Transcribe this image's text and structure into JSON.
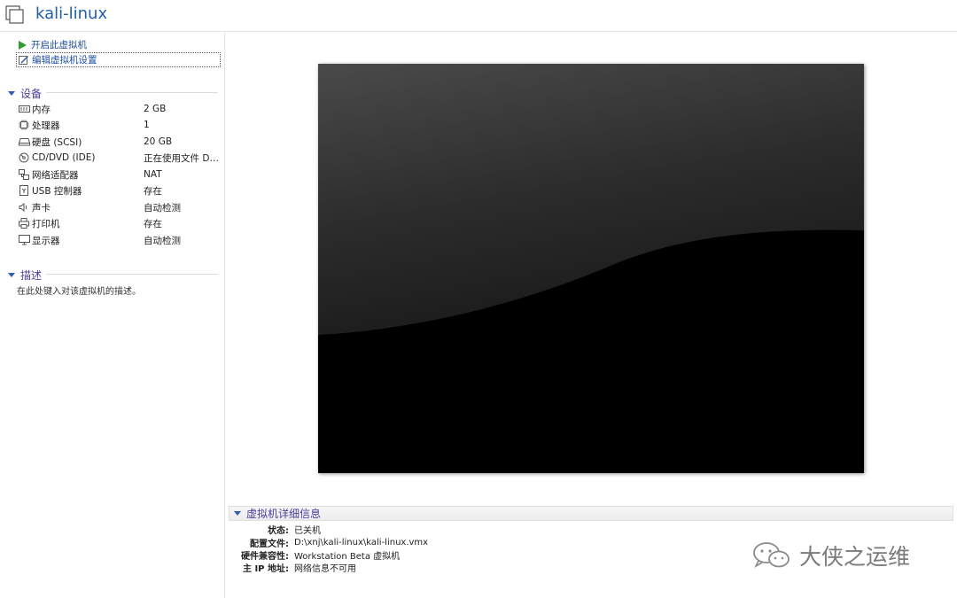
{
  "window": {
    "title": "kali-linux",
    "icon": "vm-window-icon"
  },
  "commands": [
    {
      "label": "开启此虚拟机",
      "icon": "play-icon"
    },
    {
      "label": "编辑虚拟机设置",
      "icon": "edit-settings-icon"
    }
  ],
  "devices": {
    "title": "设备",
    "items": [
      {
        "name": "内存",
        "value": "2 GB",
        "icon": "memory-icon"
      },
      {
        "name": "处理器",
        "value": "1",
        "icon": "cpu-icon"
      },
      {
        "name": "硬盘 (SCSI)",
        "value": "20 GB",
        "icon": "harddisk-icon"
      },
      {
        "name": "CD/DVD (IDE)",
        "value": "正在使用文件 D:...",
        "icon": "cd-dvd-icon"
      },
      {
        "name": "网络适配器",
        "value": "NAT",
        "icon": "network-adapter-icon"
      },
      {
        "name": "USB 控制器",
        "value": "存在",
        "icon": "usb-icon"
      },
      {
        "name": "声卡",
        "value": "自动检测",
        "icon": "sound-icon"
      },
      {
        "name": "打印机",
        "value": "存在",
        "icon": "printer-icon"
      },
      {
        "name": "显示器",
        "value": "自动检测",
        "icon": "display-icon"
      }
    ]
  },
  "description": {
    "title": "描述",
    "placeholder": "在此处键入对该虚拟机的描述。"
  },
  "details": {
    "title": "虚拟机详细信息",
    "rows": [
      {
        "key": "状态:",
        "value": "已关机"
      },
      {
        "key": "配置文件:",
        "value": "D:\\xnj\\kali-linux\\kali-linux.vmx"
      },
      {
        "key": "硬件兼容性:",
        "value": "Workstation Beta 虚拟机"
      },
      {
        "key": "主 IP 地址:",
        "value": "网络信息不可用"
      }
    ]
  },
  "watermark": {
    "text": "大侠之运维",
    "icon": "wechat-icon"
  },
  "colors": {
    "title": "#1e5fa8",
    "section": "#4a3f9e",
    "link": "#1e4fa0",
    "play": "#2e9e2e"
  }
}
